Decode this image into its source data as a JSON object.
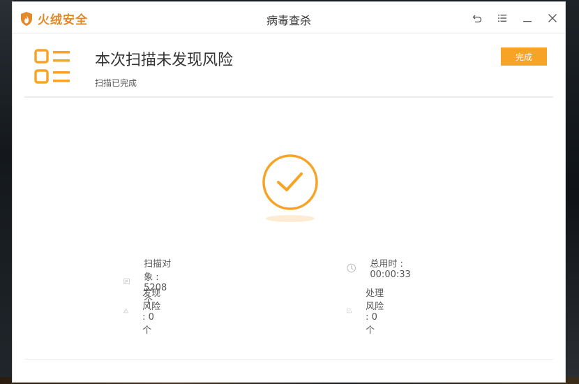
{
  "app": {
    "brand": "火绒安全",
    "title": "病毒查杀"
  },
  "window_controls": [
    "back-icon",
    "menu-icon",
    "minimize-icon",
    "close-icon"
  ],
  "result": {
    "headline": "本次扫描未发现风险",
    "subline": "扫描已完成",
    "done_label": "完成"
  },
  "stats": {
    "scanned": "扫描对象 : 5208个",
    "elapsed": "总用时 : 00:00:33",
    "risks_found": "发现风险 : 0个",
    "risks_handled": "处理风险 : 0个"
  },
  "colors": {
    "accent": "#f7a325",
    "brand": "#e3892a",
    "icon_gray": "#b5b5b5"
  }
}
